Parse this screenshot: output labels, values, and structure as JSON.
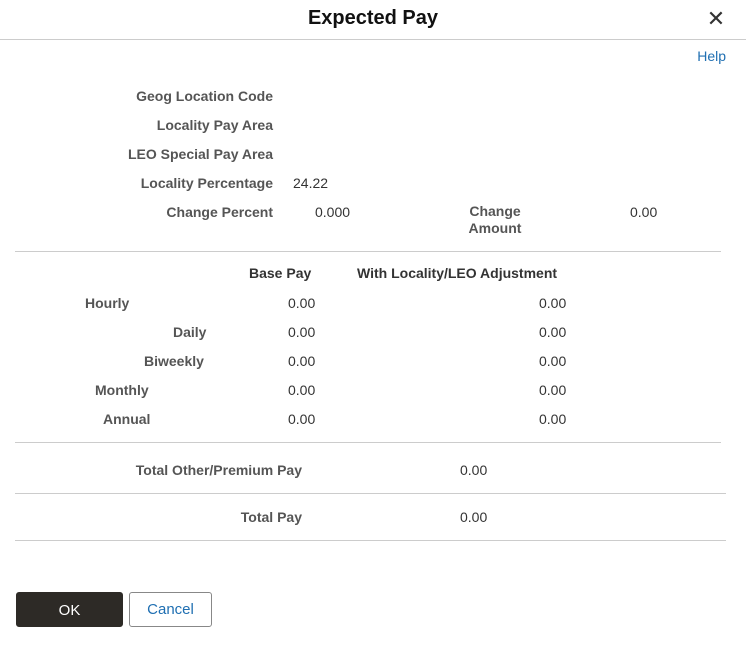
{
  "dialog": {
    "title": "Expected Pay",
    "close_icon": "close-icon",
    "help_label": "Help"
  },
  "location": {
    "geog_location_code_label": "Geog Location Code",
    "geog_location_code_value": "",
    "locality_pay_area_label": "Locality Pay Area",
    "locality_pay_area_value": "",
    "leo_special_pay_area_label": "LEO Special Pay Area",
    "leo_special_pay_area_value": "",
    "locality_percentage_label": "Locality Percentage",
    "locality_percentage_value": "24.22",
    "change_percent_label": "Change Percent",
    "change_percent_value": "0.000",
    "change_amount_label_line1": "Change",
    "change_amount_label_line2": "Amount",
    "change_amount_value": "0.00"
  },
  "pay_table": {
    "headers": [
      "Base Pay",
      "With Locality/LEO Adjustment"
    ],
    "rows": [
      {
        "label": "Hourly",
        "base": "0.00",
        "adjusted": "0.00"
      },
      {
        "label": "Daily",
        "base": "0.00",
        "adjusted": "0.00"
      },
      {
        "label": "Biweekly",
        "base": "0.00",
        "adjusted": "0.00"
      },
      {
        "label": "Monthly",
        "base": "0.00",
        "adjusted": "0.00"
      },
      {
        "label": "Annual",
        "base": "0.00",
        "adjusted": "0.00"
      }
    ]
  },
  "totals": {
    "other_premium_label": "Total Other/Premium Pay",
    "other_premium_value": "0.00",
    "total_pay_label": "Total Pay",
    "total_pay_value": "0.00"
  },
  "buttons": {
    "ok_label": "OK",
    "cancel_label": "Cancel"
  }
}
